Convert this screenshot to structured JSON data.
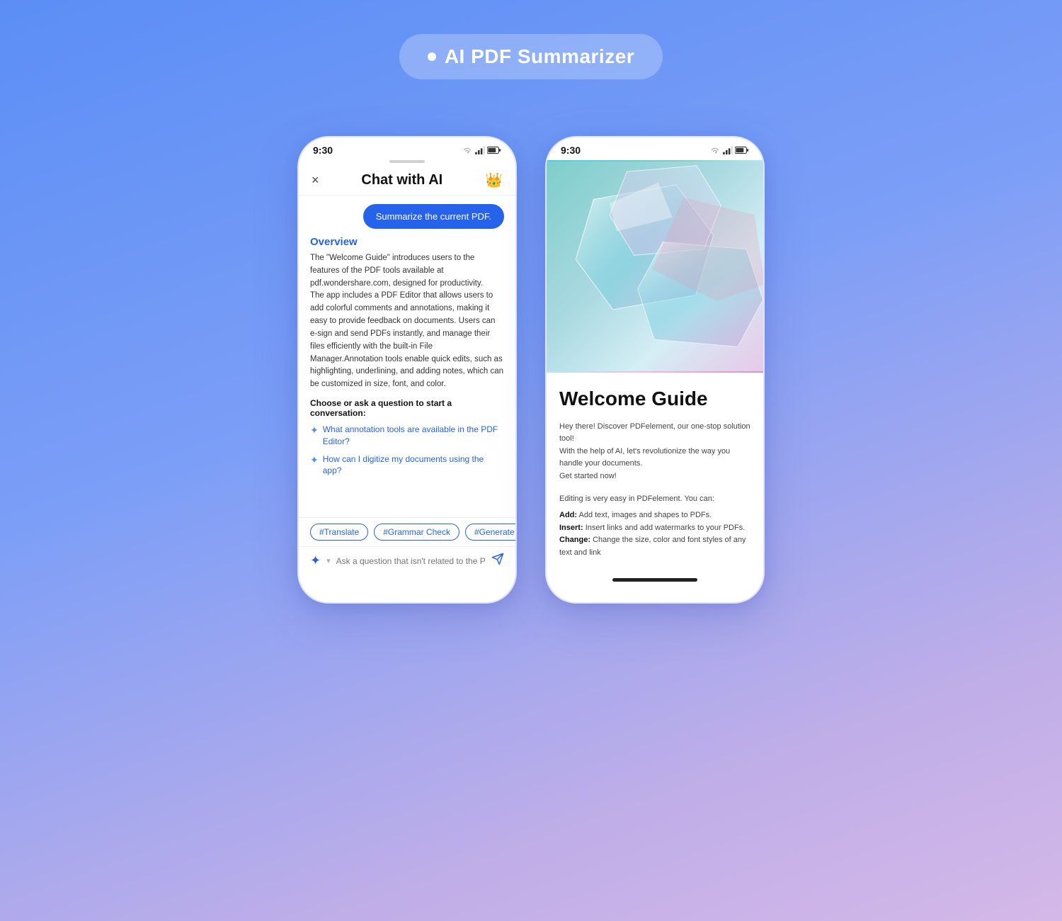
{
  "app": {
    "title": "AI PDF Summarizer"
  },
  "phone1": {
    "status_time": "9:30",
    "header": {
      "title": "Chat with AI",
      "close_label": "×",
      "crown_label": "👑"
    },
    "summarize_btn": "Summarize the current PDF.",
    "overview": {
      "title": "Overview",
      "text": "The \"Welcome Guide\" introduces users to the features of the PDF tools available at pdf.wondershare.com, designed for productivity.\nThe app includes a PDF Editor that allows users to add colorful comments and annotations, making it easy to provide feedback on documents. Users can e-sign and send PDFs instantly, and manage their files efficiently with the built-in File Manager.Annotation tools enable quick edits, such as highlighting, underlining, and adding notes, which can be customized in size, font, and color."
    },
    "starter_label": "Choose or ask a question to start a conversation:",
    "starters": [
      "What annotation tools are available in the PDF Editor?",
      "How can I digitize my documents using the app?"
    ],
    "tags": [
      "#Translate",
      "#Grammar Check",
      "#Generate"
    ],
    "input_placeholder": "Ask a question that isn't related to the PDF."
  },
  "phone2": {
    "status_time": "9:30",
    "guide_title": "Welcome Guide",
    "guide_intro": "Hey there! Discover PDFelement, our one-stop solution tool!\nWith the help of AI, let's revolutionize the way you handle your documents.\nGet started now!",
    "guide_section": "Editing is very easy in PDFelement. You can:",
    "guide_bullets": [
      {
        "label": "Add:",
        "text": "Add text, images and shapes to PDFs."
      },
      {
        "label": "Insert:",
        "text": "Insert links and add watermarks to your PDFs."
      },
      {
        "label": "Change:",
        "text": "Change the size, color and font styles of any text and link"
      }
    ]
  }
}
